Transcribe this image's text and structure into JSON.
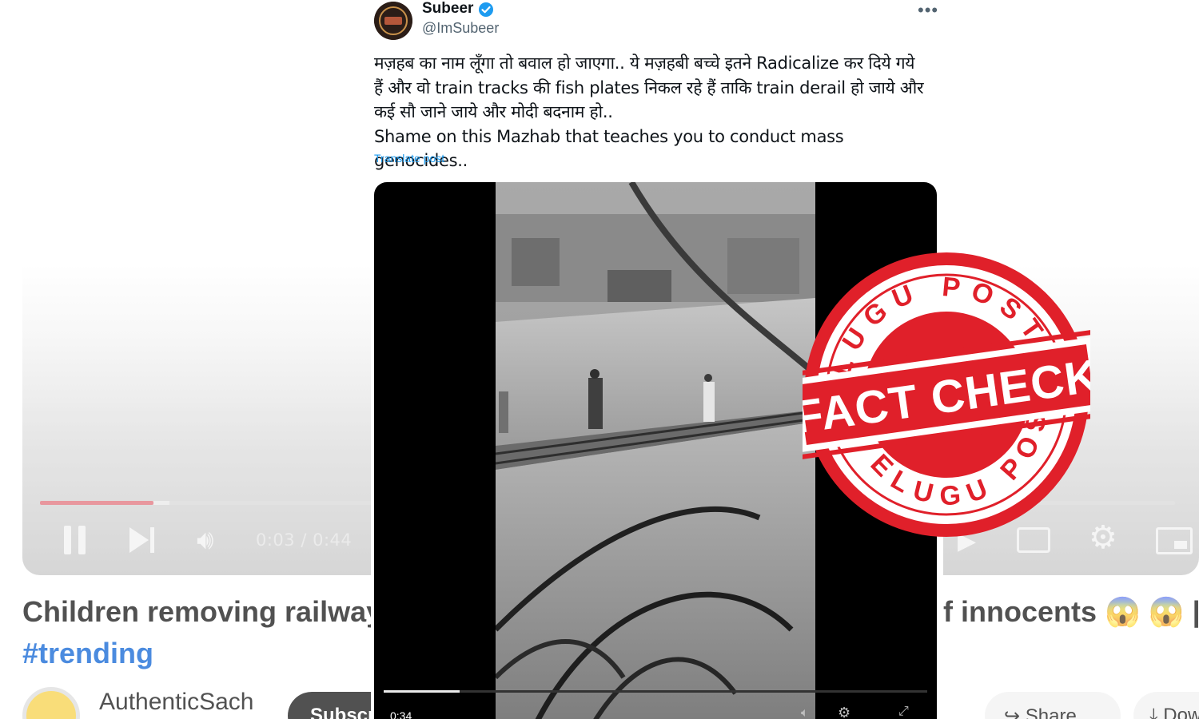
{
  "youtube": {
    "progress_fraction": 0.1,
    "time_display": "0:03 / 0:44",
    "title_left": "Children removing railway",
    "title_right": "f innocents 😱 😱 ||#",
    "hashtag": "#trending",
    "channel_name": "AuthenticSach",
    "subscribe_label": "Subscribe",
    "share_label": "Share",
    "download_label": "Download",
    "accent_color": "#ff0000"
  },
  "tweet": {
    "display_name": "Subeer",
    "handle": "@ImSubeer",
    "more_icon": "•••",
    "verified_color": "#1d9bf0",
    "text_lines": [
      "मज़हब का नाम लूँगा तो बवाल हो जाएगा.. ये मज़हबी बच्चे इतने Radicalize कर दिये गये",
      "हैं और वो train tracks की fish plates निकल रहे हैं ताकि train derail हो जाये और",
      "कई सौ जाने जाये और मोदी बदनाम हो..",
      "Shame on this Mazhab that teaches you to conduct mass genocides.."
    ],
    "translate_label": "Translate post",
    "video": {
      "elapsed": "0:34",
      "progress_fraction": 0.14
    }
  },
  "stamp": {
    "top_text": "TELUGU POST",
    "center_text": "FACT CHECK",
    "bottom_text": "TELUGU POST",
    "color": "#e0202a"
  }
}
